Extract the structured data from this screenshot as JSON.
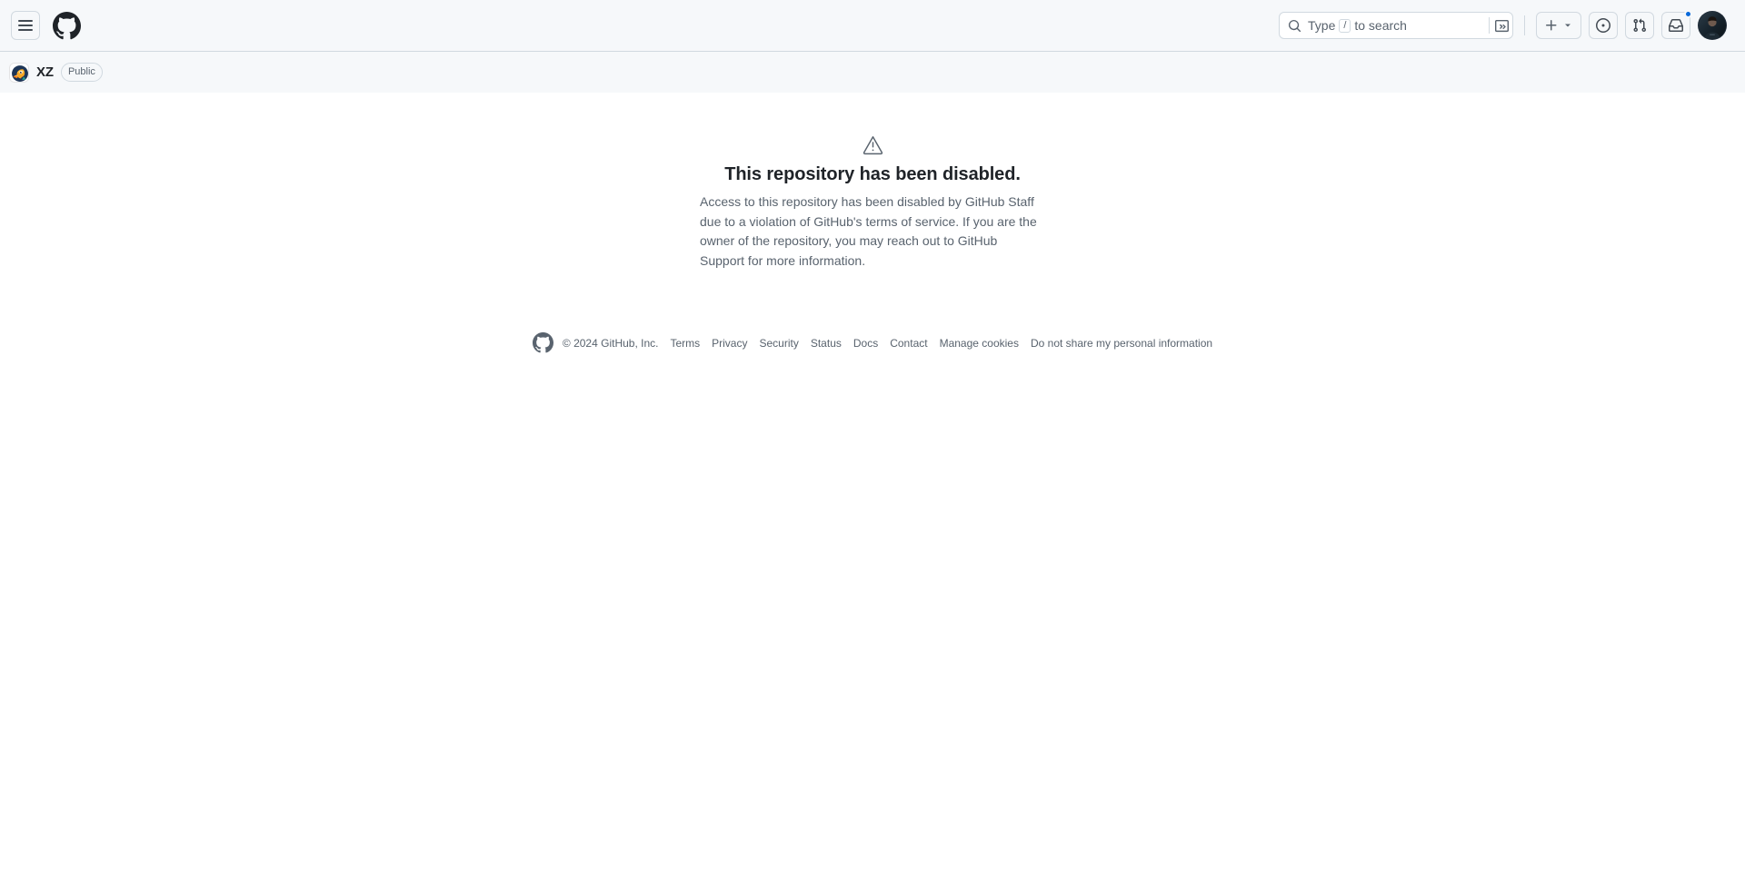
{
  "header": {
    "menu_label": "Open global navigation menu",
    "logo_label": "GitHub Homepage",
    "search": {
      "placeholder_prefix": "Type",
      "placeholder_key": "/",
      "placeholder_suffix": "to search",
      "terminal_label": "Open command palette"
    },
    "create_new_label": "Create new...",
    "issues_label": "Your issues",
    "pull_requests_label": "Your pull requests",
    "inbox_label": "Notifications",
    "has_unread_notifications": true,
    "avatar_label": "Open user account menu"
  },
  "repo": {
    "avatar_label": "Owner avatar",
    "name": "XZ",
    "visibility": "Public"
  },
  "blankslate": {
    "icon": "alert-icon",
    "title": "This repository has been disabled.",
    "body": "Access to this repository has been disabled by GitHub Staff due to a violation of GitHub's terms of service. If you are the owner of the repository, you may reach out to GitHub Support for more information."
  },
  "footer": {
    "mark_label": "GitHub",
    "copyright": "© 2024 GitHub, Inc.",
    "links": [
      {
        "label": "Terms"
      },
      {
        "label": "Privacy"
      },
      {
        "label": "Security"
      },
      {
        "label": "Status"
      },
      {
        "label": "Docs"
      },
      {
        "label": "Contact"
      },
      {
        "label": "Manage cookies"
      },
      {
        "label": "Do not share my personal information"
      }
    ]
  },
  "colors": {
    "accent": "#0969da",
    "canvas_subtle": "#f6f8fa",
    "border": "#d1d9e0",
    "fg_default": "#1f2328",
    "fg_muted": "#59636e"
  }
}
